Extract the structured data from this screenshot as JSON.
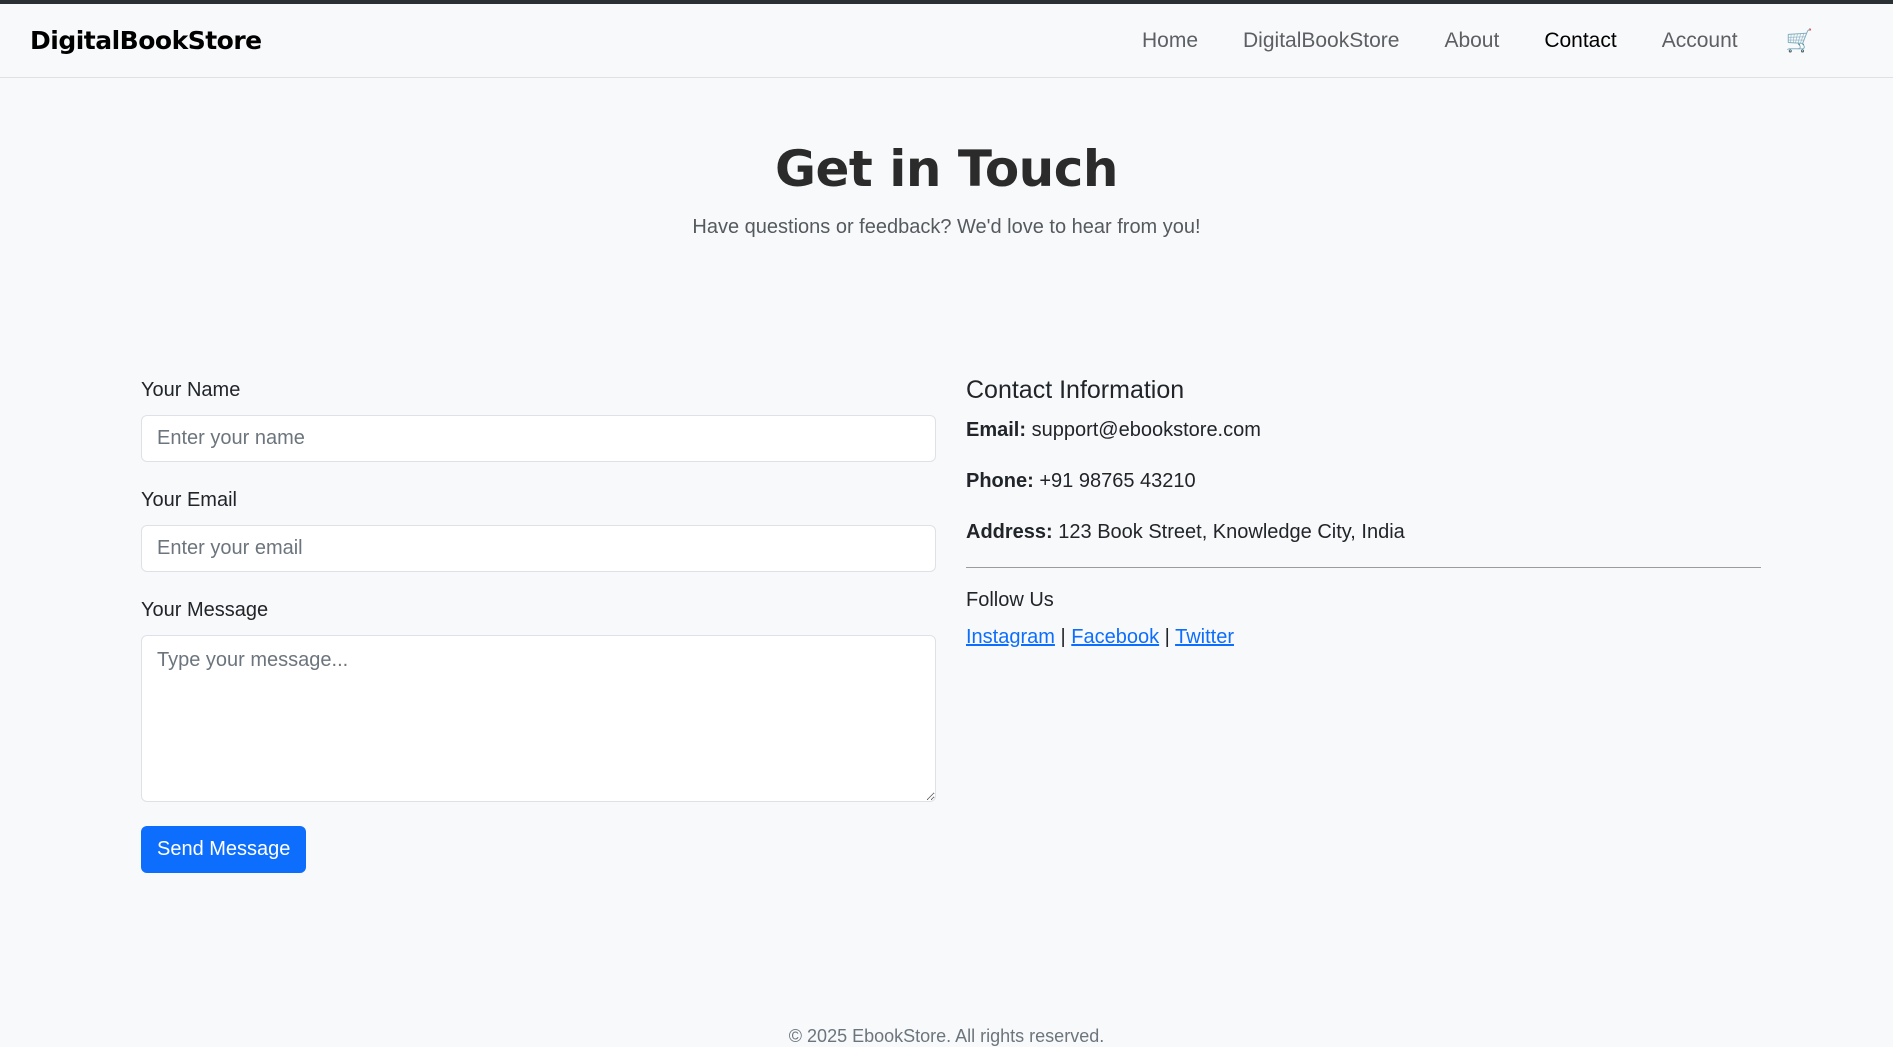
{
  "nav": {
    "brand": "DigitalBookStore",
    "links": [
      "Home",
      "DigitalBookStore",
      "About",
      "Contact",
      "Account"
    ],
    "active": "Contact",
    "cart_icon": "🛒"
  },
  "hero": {
    "title": "Get in Touch",
    "subtitle": "Have questions or feedback? We'd love to hear from you!"
  },
  "form": {
    "name_label": "Your Name",
    "name_placeholder": "Enter your name",
    "name_value": "",
    "email_label": "Your Email",
    "email_placeholder": "Enter your email",
    "email_value": "",
    "message_label": "Your Message",
    "message_placeholder": "Type your message...",
    "message_value": "",
    "submit_label": "Send Message"
  },
  "contact": {
    "heading": "Contact Information",
    "email_label": "Email:",
    "email_value": "support@ebookstore.com",
    "phone_label": "Phone:",
    "phone_value": "+91 98765 43210",
    "address_label": "Address:",
    "address_value": "123 Book Street, Knowledge City, India",
    "follow_title": "Follow Us",
    "social": [
      "Instagram",
      "Facebook",
      "Twitter"
    ],
    "separator": "|"
  },
  "footer": {
    "text": "© 2025 EbookStore. All rights reserved."
  },
  "colors": {
    "primary": "#0d6efd",
    "background": "#f8f9fa"
  }
}
